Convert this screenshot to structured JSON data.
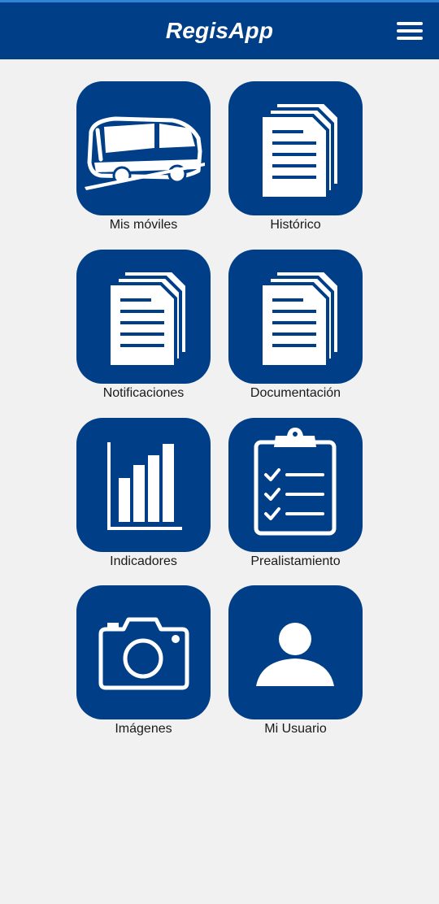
{
  "app": {
    "title": "RegisApp",
    "header_color": "#003f87",
    "accent_line_color": "#2f86d6",
    "background_color": "#f1f1f2"
  },
  "header": {
    "menu_icon": "hamburger-menu-icon"
  },
  "tiles": [
    {
      "label": "Mis móviles",
      "icon": "bus-icon"
    },
    {
      "label": "Histórico",
      "icon": "documents-icon"
    },
    {
      "label": "Notificaciones",
      "icon": "documents-icon"
    },
    {
      "label": "Documentación",
      "icon": "documents-icon"
    },
    {
      "label": "Indicadores",
      "icon": "bar-chart-icon"
    },
    {
      "label": "Prealistamiento",
      "icon": "clipboard-checklist-icon"
    },
    {
      "label": "Imágenes",
      "icon": "camera-icon"
    },
    {
      "label": "Mi Usuario",
      "icon": "user-icon"
    }
  ]
}
